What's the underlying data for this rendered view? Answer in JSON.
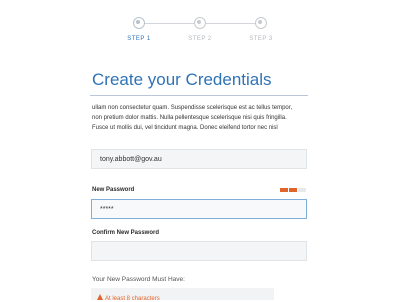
{
  "stepper": {
    "steps": [
      {
        "label": "STEP 1",
        "active": true
      },
      {
        "label": "STEP 2",
        "active": false
      },
      {
        "label": "STEP 3",
        "active": false
      }
    ]
  },
  "page": {
    "title": "Create your Credentials",
    "description_lines": [
      "ullam non consectetur quam. Suspendisse scelerisque est ac tellus tempor,",
      "non pretium dolor mattis. Nulla pellentesque scelerisque nisi quis fringilla.",
      "Fusce ut mollis dui, vel tincidunt magna. Donec eleifend tortor nec nisl"
    ]
  },
  "form": {
    "email_value": "tony.abbott@gov.au",
    "new_password_label": "New Password",
    "new_password_value": "*****",
    "password_strength": {
      "filled": 2,
      "total": 3
    },
    "confirm_password_label": "Confirm New Password",
    "confirm_password_value": ""
  },
  "requirements": {
    "title": "Your New Password Must Have:",
    "items": [
      {
        "text": "At least 8 characters",
        "icon": "warning-icon"
      }
    ]
  },
  "colors": {
    "accent": "#2f73b6",
    "strength": "#e0652b",
    "warning": "#e0652b"
  }
}
